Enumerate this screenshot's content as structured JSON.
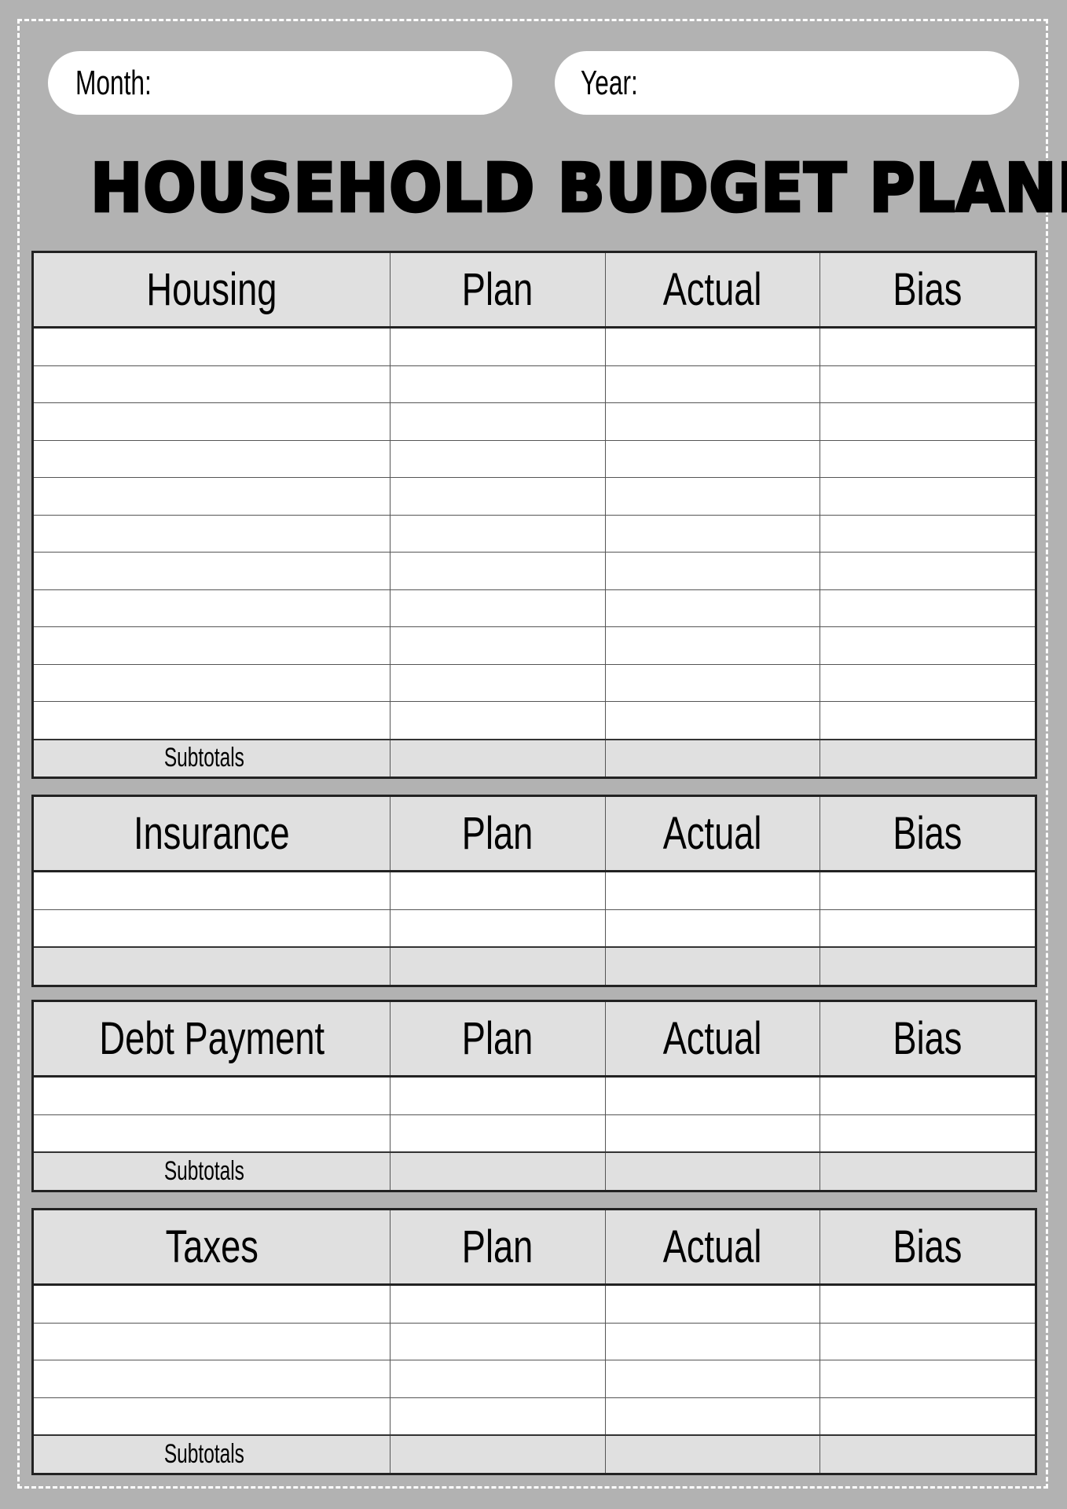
{
  "header": {
    "month_label": "Month:",
    "month_value": "",
    "year_label": "Year:",
    "year_value": ""
  },
  "title": "HOUSEHOLD BUDGET PLANNER",
  "columns": [
    "Plan",
    "Actual",
    "Bias"
  ],
  "sections": [
    {
      "id": "housing",
      "name": "Housing",
      "entry_rows": 11,
      "footer_label": "Subtotals"
    },
    {
      "id": "insurance",
      "name": "Insurance",
      "entry_rows": 2,
      "footer_label": ""
    },
    {
      "id": "debt",
      "name": "Debt Payment",
      "entry_rows": 2,
      "footer_label": "Subtotals"
    },
    {
      "id": "taxes",
      "name": "Taxes",
      "entry_rows": 4,
      "footer_label": "Subtotals"
    }
  ],
  "colors": {
    "background": "#b2b2b2",
    "header_fill": "#e0e0e0",
    "cell_fill": "#ffffff",
    "border": "#222222",
    "dashed_border": "#ffffff"
  }
}
